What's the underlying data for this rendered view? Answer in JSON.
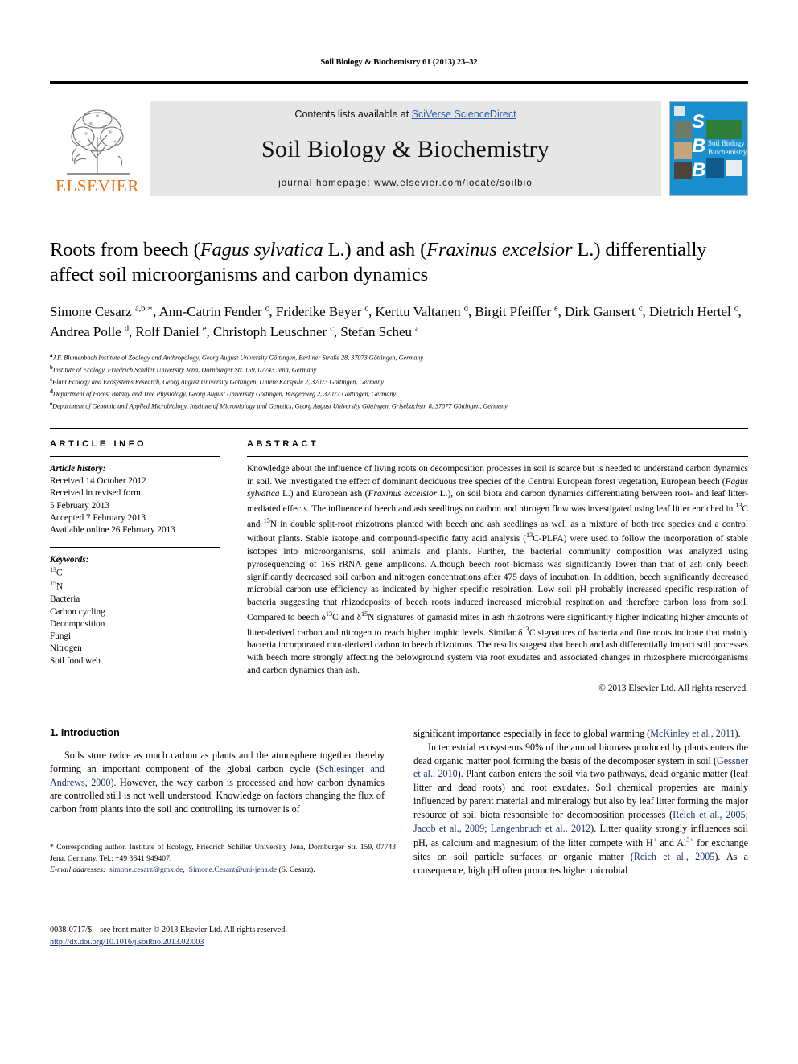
{
  "running_head": "Soil Biology & Biochemistry 61 (2013) 23–32",
  "masthead": {
    "elsevier_wordmark": "ELSEVIER",
    "contents_prefix": "Contents lists available at ",
    "contents_link": "SciVerse ScienceDirect",
    "journal_title": "Soil Biology & Biochemistry",
    "homepage_line": "journal homepage: www.elsevier.com/locate/soilbio",
    "cover_letters": [
      "S",
      "B",
      "B"
    ],
    "cover_caption_line1": "Soil Biology &",
    "cover_caption_line2": "Biochemistry",
    "accent_orange": "#E8731A",
    "link_blue": "#2a5db0",
    "cover_blue": "#1a8fd0"
  },
  "article": {
    "title_html": "Roots from beech (<i>Fagus sylvatica</i> L.) and ash (<i>Fraxinus excelsior</i> L.) differentially affect soil microorganisms and carbon dynamics",
    "authors_html": "Simone Cesarz <sup>a,b,∗</sup>, Ann-Catrin Fender <sup>c</sup>, Friderike Beyer <sup>c</sup>, Kerttu Valtanen <sup>d</sup>, Birgit Pfeiffer <sup>e</sup>, Dirk Gansert <sup>c</sup>, Dietrich Hertel <sup>c</sup>, Andrea Polle <sup>d</sup>, Rolf Daniel <sup>e</sup>, Christoph Leuschner <sup>c</sup>, Stefan Scheu <sup>a</sup>",
    "affiliations": [
      {
        "marker": "a",
        "text": "J.F. Blumenbach Institute of Zoology and Anthropology, Georg August University Göttingen, Berliner Straße 28, 37073 Göttingen, Germany"
      },
      {
        "marker": "b",
        "text": "Institute of Ecology, Friedrich Schiller University Jena, Dornburger Str. 159, 07743 Jena, Germany"
      },
      {
        "marker": "c",
        "text": "Plant Ecology and Ecosystems Research, Georg August University Göttingen, Untere Karspüle 2, 37073 Göttingen, Germany"
      },
      {
        "marker": "d",
        "text": "Department of Forest Botany and Tree Physiology, Georg August University Göttingen, Büsgenweg 2, 37077 Göttingen, Germany"
      },
      {
        "marker": "e",
        "text": "Department of Genomic and Applied Microbiology, Institute of Microbiology and Genetics, Georg August University Göttingen, Grisebachstr. 8, 37077 Göttingen, Germany"
      }
    ]
  },
  "article_info": {
    "heading": "ARTICLE INFO",
    "history_label": "Article history:",
    "history_lines": [
      "Received 14 October 2012",
      "Received in revised form",
      "5 February 2013",
      "Accepted 7 February 2013",
      "Available online 26 February 2013"
    ],
    "keywords_label": "Keywords:",
    "keywords_html": [
      "<sup>13</sup>C",
      "<sup>15</sup>N",
      "Bacteria",
      "Carbon cycling",
      "Decomposition",
      "Fungi",
      "Nitrogen",
      "Soil food web"
    ]
  },
  "abstract": {
    "heading": "ABSTRACT",
    "body_html": "Knowledge about the influence of living roots on decomposition processes in soil is scarce but is needed to understand carbon dynamics in soil. We investigated the effect of dominant deciduous tree species of the Central European forest vegetation, European beech (<i>Fagus sylvatica</i> L.) and European ash (<i>Fraxinus excelsior</i> L.), on soil biota and carbon dynamics differentiating between root- and leaf litter-mediated effects. The influence of beech and ash seedlings on carbon and nitrogen flow was investigated using leaf litter enriched in <sup>13</sup>C and <sup>15</sup>N in double split-root rhizotrons planted with beech and ash seedlings as well as a mixture of both tree species and a control without plants. Stable isotope and compound-specific fatty acid analysis (<sup>13</sup>C-PLFA) were used to follow the incorporation of stable isotopes into microorganisms, soil animals and plants. Further, the bacterial community composition was analyzed using pyrosequencing of 16S rRNA gene amplicons. Although beech root biomass was significantly lower than that of ash only beech significantly decreased soil carbon and nitrogen concentrations after 475 days of incubation. In addition, beech significantly decreased microbial carbon use efficiency as indicated by higher specific respiration. Low soil pH probably increased specific respiration of bacteria suggesting that rhizodeposits of beech roots induced increased microbial respiration and therefore carbon loss from soil. Compared to beech δ<sup>13</sup>C and δ<sup>15</sup>N signatures of gamasid mites in ash rhizotrons were significantly higher indicating higher amounts of litter-derived carbon and nitrogen to reach higher trophic levels. Similar δ<sup>13</sup>C signatures of bacteria and fine roots indicate that mainly bacteria incorporated root-derived carbon in beech rhizotrons. The results suggest that beech and ash differentially impact soil processes with beech more strongly affecting the belowground system via root exudates and associated changes in rhizosphere microorganisms and carbon dynamics than ash.",
    "copyright": "© 2013 Elsevier Ltd. All rights reserved."
  },
  "introduction": {
    "heading": "1. Introduction",
    "left_paragraph_html": "Soils store twice as much carbon as plants and the atmosphere together thereby forming an important component of the global carbon cycle (<span class=\"ref\">Schlesinger and Andrews, 2000</span>). However, the way carbon is processed and how carbon dynamics are controlled still is not well understood. Knowledge on factors changing the flux of carbon from plants into the soil and controlling its turnover is of",
    "right_paragraph1_html": "significant importance especially in face to global warming (<span class=\"ref\">McKinley et al., 2011</span>).",
    "right_paragraph2_html": "In terrestrial ecosystems 90% of the annual biomass produced by plants enters the dead organic matter pool forming the basis of the decomposer system in soil (<span class=\"ref\">Gessner et al., 2010</span>). Plant carbon enters the soil via two pathways, dead organic matter (leaf litter and dead roots) and root exudates. Soil chemical properties are mainly influenced by parent material and mineralogy but also by leaf litter forming the major resource of soil biota responsible for decomposition processes (<span class=\"ref\">Reich et al., 2005; Jacob et al., 2009; Langenbruch et al., 2012</span>). Litter quality strongly influences soil pH, as calcium and magnesium of the litter compete with H<sup>+</sup> and Al<sup>3+</sup> for exchange sites on soil particle surfaces or organic matter (<span class=\"ref\">Reich et al., 2005</span>). As a consequence, high pH often promotes higher microbial"
  },
  "footnotes": {
    "corresponding_html": "* Corresponding author. Institute of Ecology, Friedrich Schiller University Jena, Dornburger Str. 159, 07743 Jena, Germany. Tel.: +49 3641 949407.",
    "email_label": "E-mail addresses:",
    "email_1": "simone.cesarz@gmx.de",
    "email_2": "Simone.Cesarz@uni-jena.de",
    "email_suffix": "(S. Cesarz).",
    "issn_line": "0038-0717/$ – see front matter © 2013 Elsevier Ltd. All rights reserved.",
    "doi_line": "http://dx.doi.org/10.1016/j.soilbio.2013.02.003"
  }
}
